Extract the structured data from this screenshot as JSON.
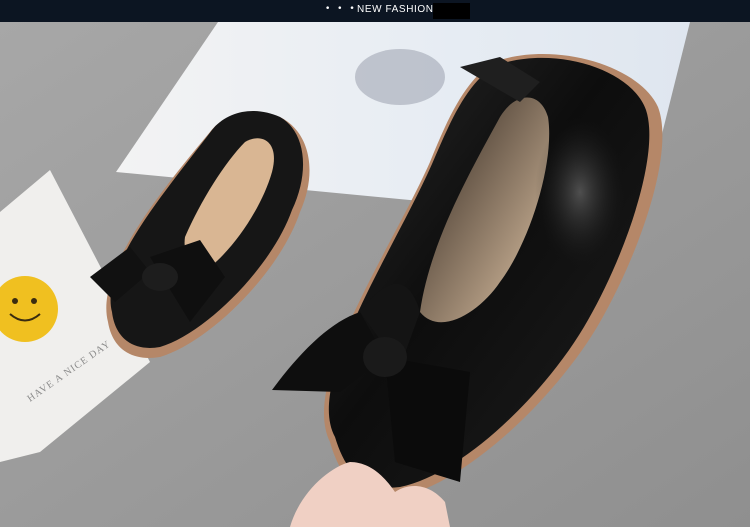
{
  "header": {
    "dots": "• • •",
    "label": "NEW FASHION"
  },
  "photo": {
    "subject": "black-leather-bow-ballet-flats",
    "card_text": "HAVE A NICE DAY",
    "colors": {
      "background": "#9c9c9c",
      "shoe": "#151515",
      "sole": "#b58768",
      "insole": "#d9b693",
      "card": "#f2f0ee",
      "smiley": "#f0c020"
    }
  }
}
